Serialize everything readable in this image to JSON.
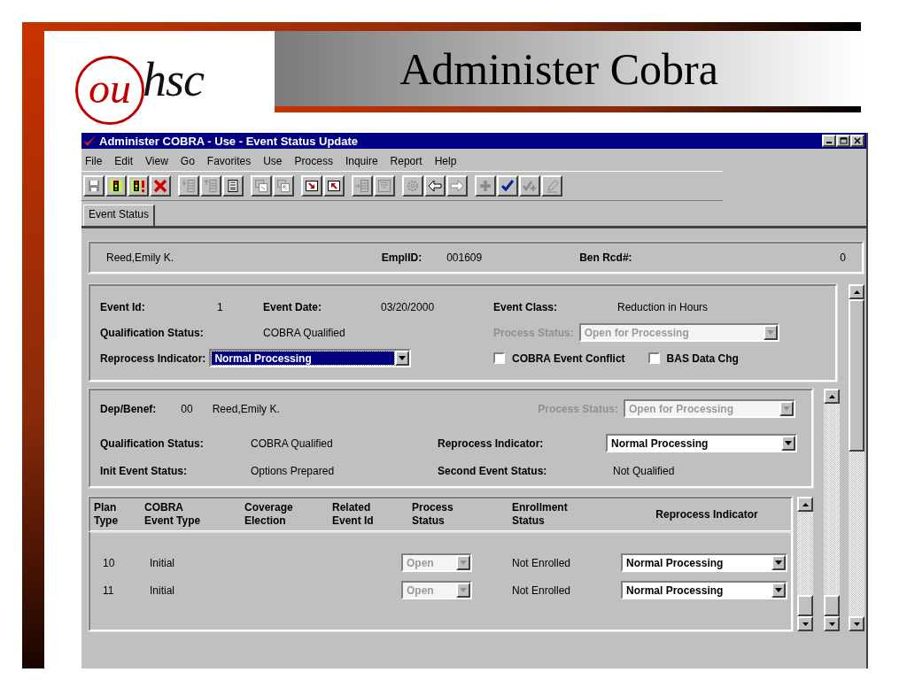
{
  "slide": {
    "logo": {
      "mark": "ou",
      "text": "hsc"
    },
    "title": "Administer Cobra"
  },
  "window": {
    "title": "Administer COBRA - Use - Event Status Update"
  },
  "menu": [
    "File",
    "Edit",
    "View",
    "Go",
    "Favorites",
    "Use",
    "Process",
    "Inquire",
    "Report",
    "Help"
  ],
  "toolbar": [
    [
      {
        "kind": "save",
        "disabled": true
      },
      {
        "kind": "traffic-light",
        "disabled": false
      },
      {
        "kind": "traffic-light-alert",
        "disabled": false
      },
      {
        "kind": "delete",
        "disabled": false
      }
    ],
    [
      {
        "kind": "row-down",
        "disabled": true
      },
      {
        "kind": "row-up",
        "disabled": true
      },
      {
        "kind": "list",
        "disabled": false
      }
    ],
    [
      {
        "kind": "windows",
        "disabled": true
      },
      {
        "kind": "windows-up",
        "disabled": true
      }
    ],
    [
      {
        "kind": "arrow-down-right",
        "disabled": false
      },
      {
        "kind": "arrow-up-left",
        "disabled": false
      }
    ],
    [
      {
        "kind": "insert-row",
        "disabled": true
      },
      {
        "kind": "form",
        "disabled": true
      }
    ],
    [
      {
        "kind": "gear",
        "disabled": true
      },
      {
        "kind": "back",
        "disabled": false
      },
      {
        "kind": "forward",
        "disabled": true
      }
    ],
    [
      {
        "kind": "plus",
        "disabled": true
      },
      {
        "kind": "check",
        "disabled": false
      },
      {
        "kind": "check-plus",
        "disabled": true
      },
      {
        "kind": "pencil",
        "disabled": true
      }
    ]
  ],
  "tabs": [
    {
      "label": "Event Status",
      "selected": true
    }
  ],
  "employee": {
    "name": "Reed,Emily K.",
    "emplid_label": "EmplID:",
    "emplid": "001609",
    "ben_rcd_label": "Ben Rcd#:",
    "ben_rcd": "0"
  },
  "event": {
    "id_label": "Event Id:",
    "id": "1",
    "date_label": "Event Date:",
    "date": "03/20/2000",
    "class_label": "Event Class:",
    "class": "Reduction in Hours",
    "qualification_label": "Qualification Status:",
    "qualification": "COBRA Qualified",
    "process_status": {
      "label": "Process Status:",
      "value": "Open for Processing",
      "disabled": true,
      "focused": false
    },
    "reprocess": {
      "label": "Reprocess Indicator:",
      "value": "Normal Processing",
      "disabled": false,
      "focused": true
    },
    "checkboxes": [
      {
        "label": "COBRA Event Conflict",
        "checked": false
      },
      {
        "label": "BAS Data Chg",
        "checked": false
      }
    ]
  },
  "dependent": {
    "label": "Dep/Benef:",
    "id": "00",
    "name": "Reed,Emily K.",
    "process_status": {
      "label": "Process Status:",
      "value": "Open for Processing",
      "disabled": true,
      "focused": false
    },
    "qualification_label": "Qualification Status:",
    "qualification": "COBRA Qualified",
    "reprocess": {
      "label": "Reprocess Indicator:",
      "value": "Normal Processing",
      "disabled": false,
      "focused": false
    },
    "init_label": "Init Event Status:",
    "init": "Options Prepared",
    "second_label": "Second Event Status:",
    "second": "Not Qualified"
  },
  "plans": {
    "columns": [
      "Plan\nType",
      "COBRA\nEvent Type",
      "Coverage\nElection",
      "Related\nEvent Id",
      "Process\nStatus",
      "Enrollment\nStatus",
      "Reprocess Indicator"
    ],
    "rows": [
      {
        "plan_type": "10",
        "event_type": "Initial",
        "process_status": {
          "value": "Open",
          "disabled": true,
          "focused": false
        },
        "enrollment_status": "Not Enrolled",
        "reprocess": {
          "value": "Normal Processing",
          "disabled": false,
          "focused": false
        }
      },
      {
        "plan_type": "11",
        "event_type": "Initial",
        "process_status": {
          "value": "Open",
          "disabled": true,
          "focused": false
        },
        "enrollment_status": "Not Enrolled",
        "reprocess": {
          "value": "Normal Processing",
          "disabled": false,
          "focused": false
        }
      }
    ]
  }
}
